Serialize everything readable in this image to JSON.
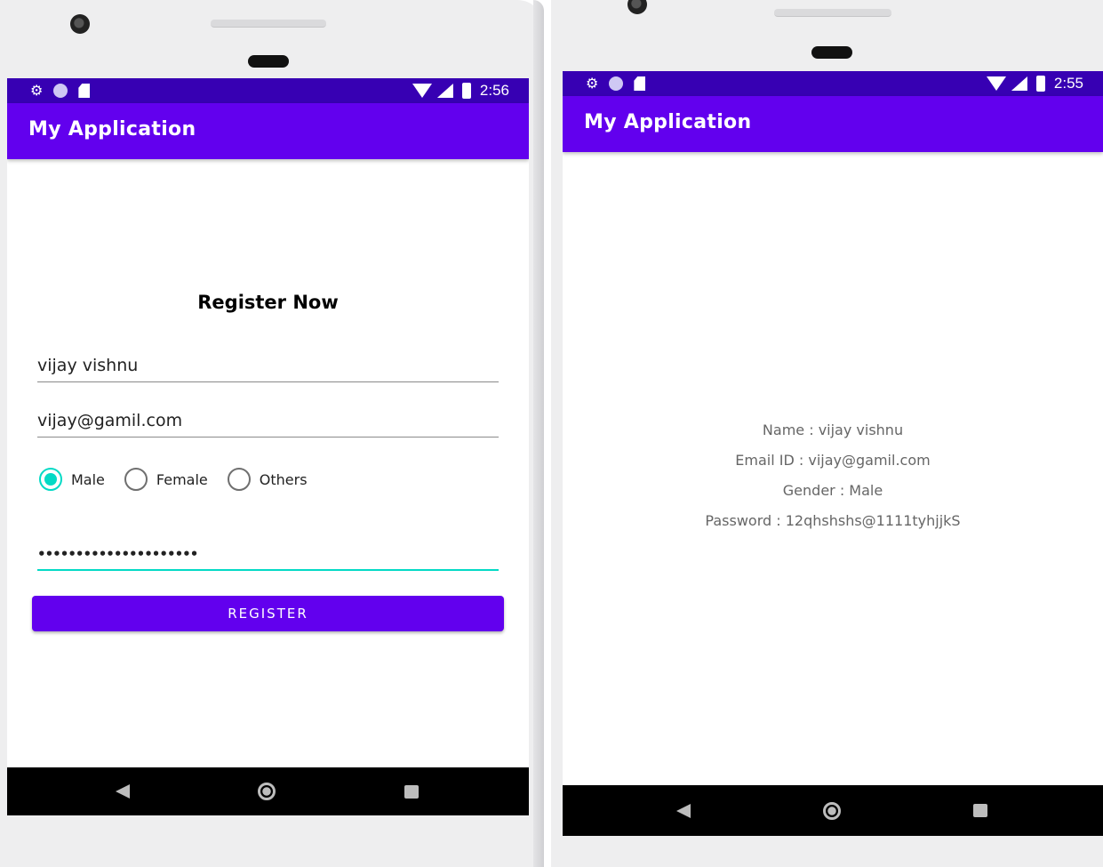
{
  "left_screen": {
    "status_bar": {
      "time": "2:56"
    },
    "app_bar": {
      "title": "My Application"
    },
    "form": {
      "title": "Register Now",
      "name_value": "vijay vishnu",
      "email_value": "vijay@gamil.com",
      "gender_options": [
        "Male",
        "Female",
        "Others"
      ],
      "selected_gender": "Male",
      "password_masked": "•••••••••••••••••••••",
      "register_label": "REGISTER"
    }
  },
  "right_screen": {
    "status_bar": {
      "time": "2:55"
    },
    "app_bar": {
      "title": "My Application"
    },
    "details": {
      "name": "Name : vijay vishnu",
      "email": "Email ID : vijay@gamil.com",
      "gender": "Gender : Male",
      "password": "Password : 12qhshshs@1111tyhjjkS"
    }
  },
  "colors": {
    "status_bar": "#3700b3",
    "app_bar": "#6200ee",
    "accent": "#03dac5",
    "nav_bar": "#000000"
  }
}
